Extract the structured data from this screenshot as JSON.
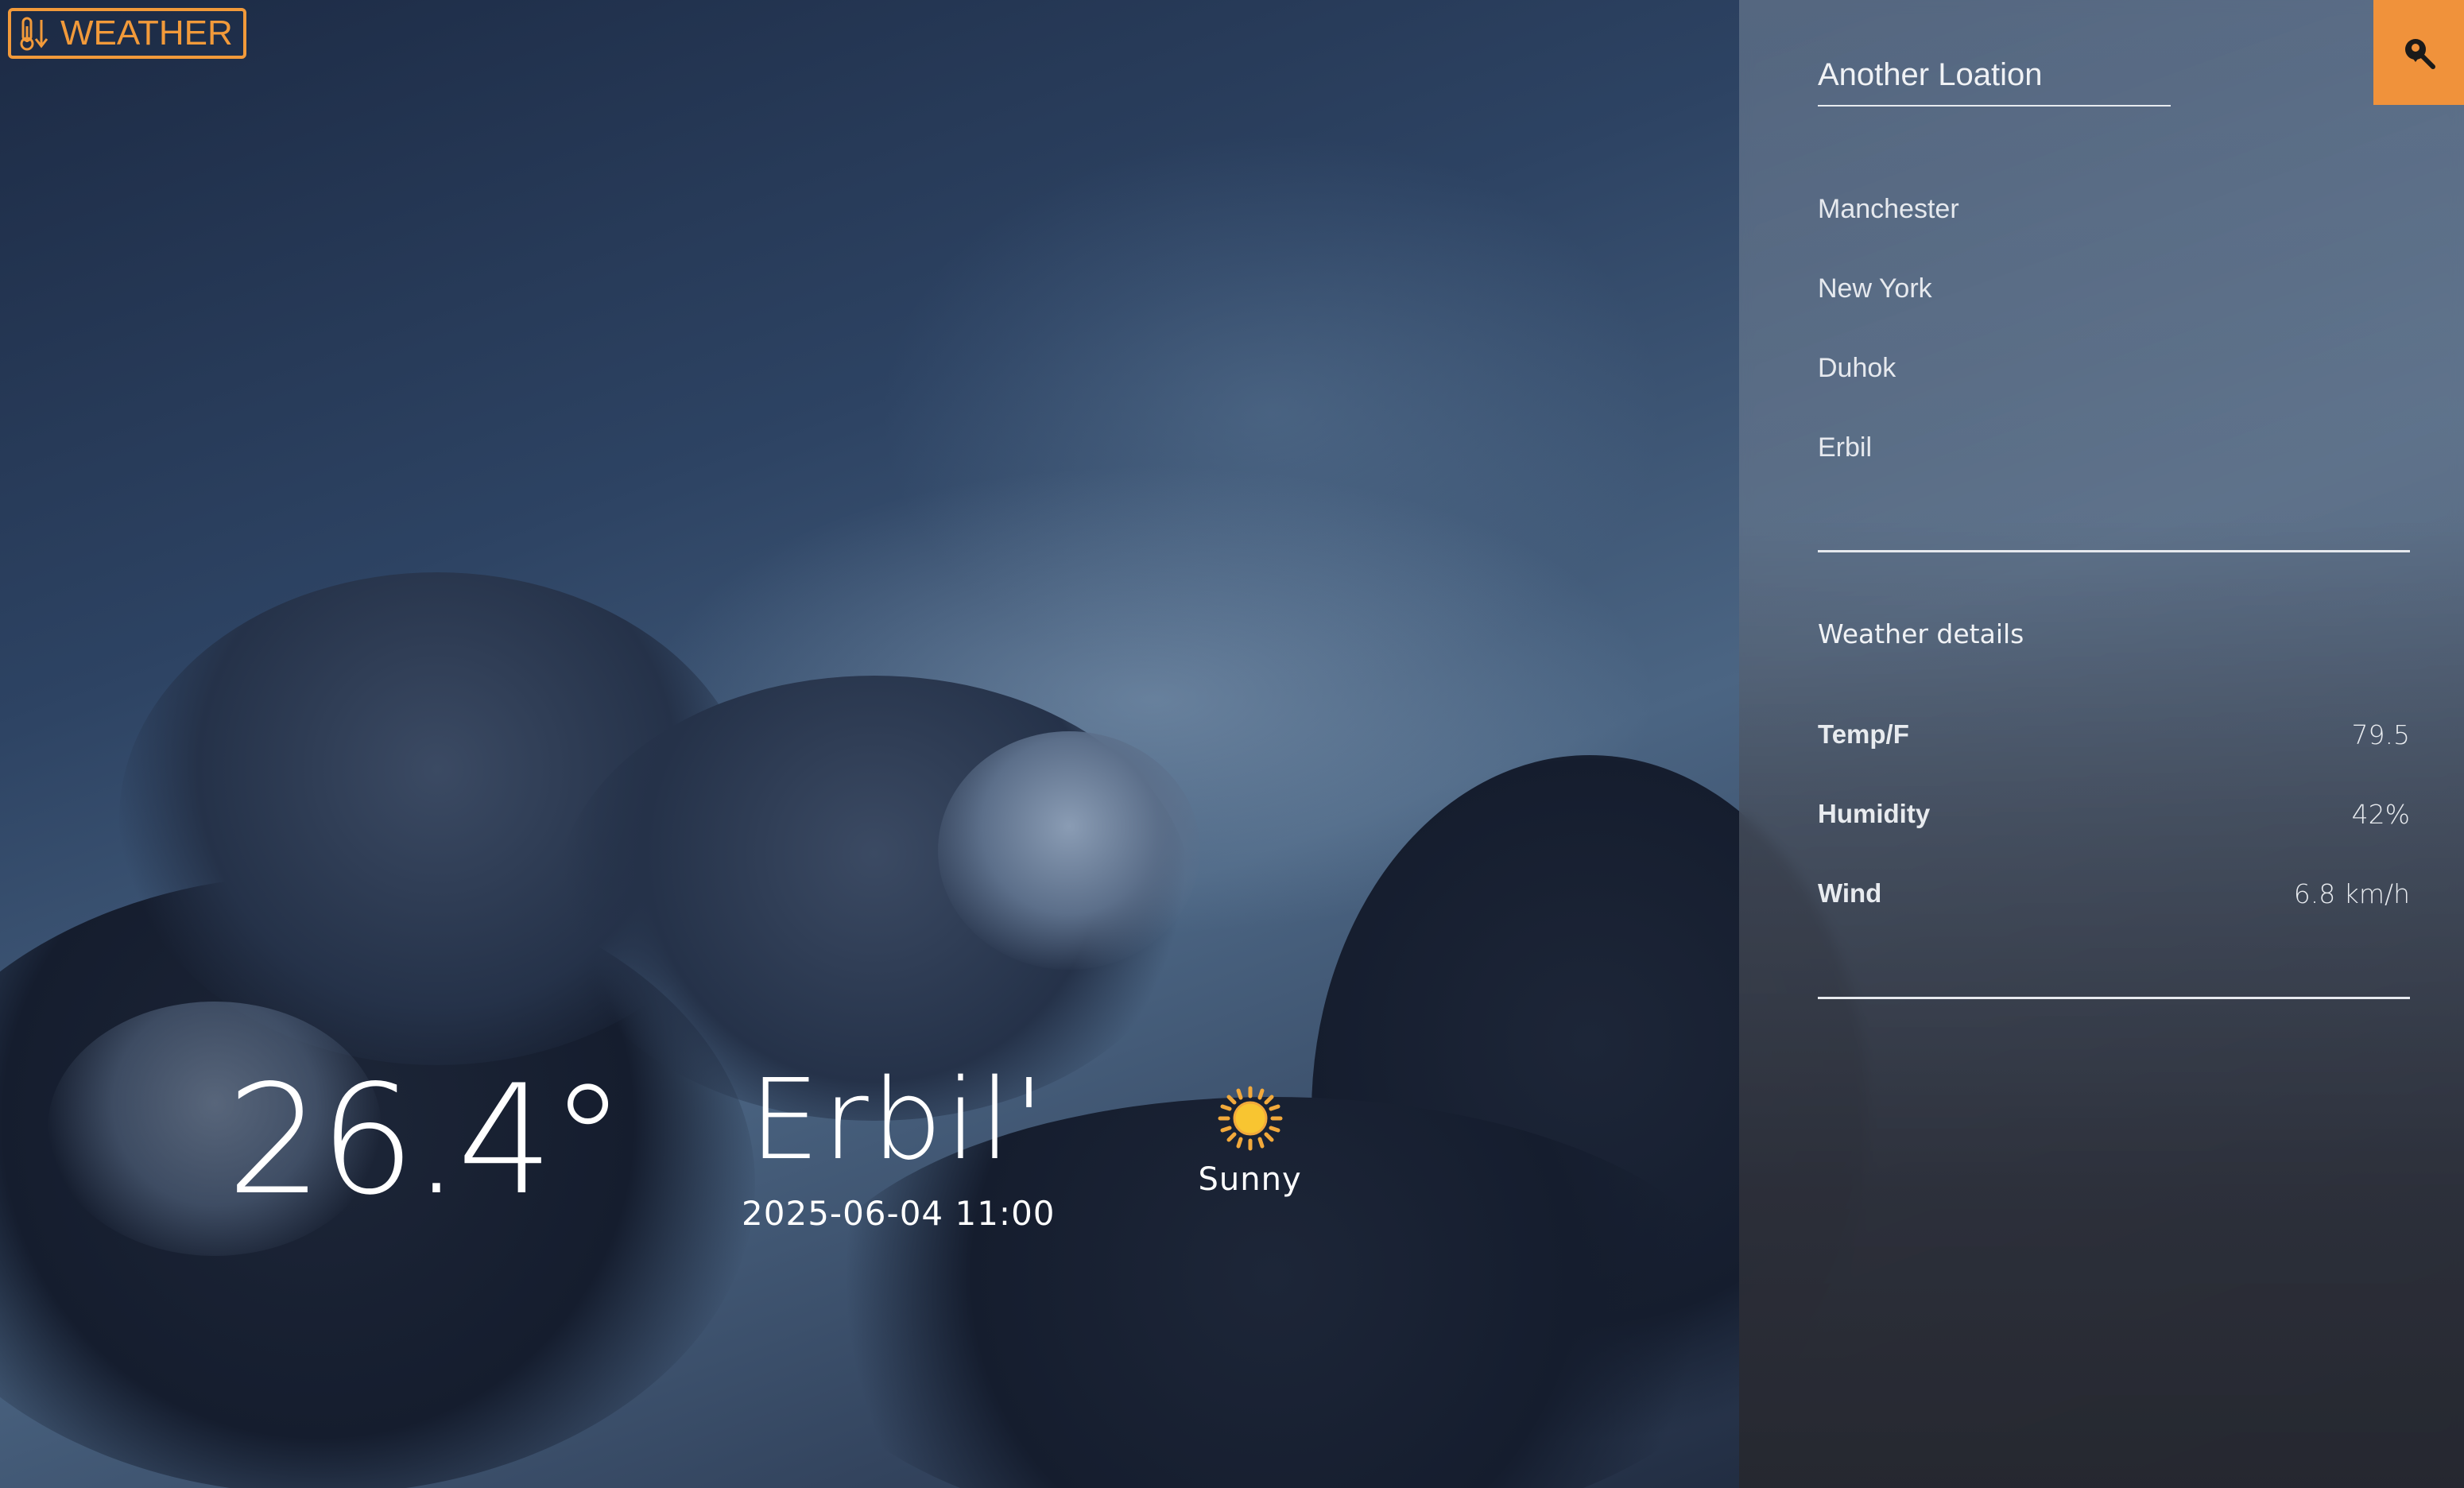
{
  "app": {
    "logo_text": "WEATHER"
  },
  "current": {
    "temperature": "26.4°",
    "city": "Erbil'",
    "datetime": "2025-06-04 11:00",
    "condition": "Sunny",
    "condition_icon": "sun-icon"
  },
  "sidebar": {
    "search": {
      "placeholder": "Another Loation",
      "icon": "search-icon"
    },
    "locations": [
      "Manchester",
      "New York",
      "Duhok",
      "Erbil"
    ],
    "details_title": "Weather details",
    "details": [
      {
        "label": "Temp/F",
        "value": "79.5"
      },
      {
        "label": "Humidity",
        "value": "42%"
      },
      {
        "label": "Wind",
        "value": "6.8 km/h"
      }
    ]
  },
  "colors": {
    "accent": "#f0923b",
    "text": "#ffffff"
  }
}
